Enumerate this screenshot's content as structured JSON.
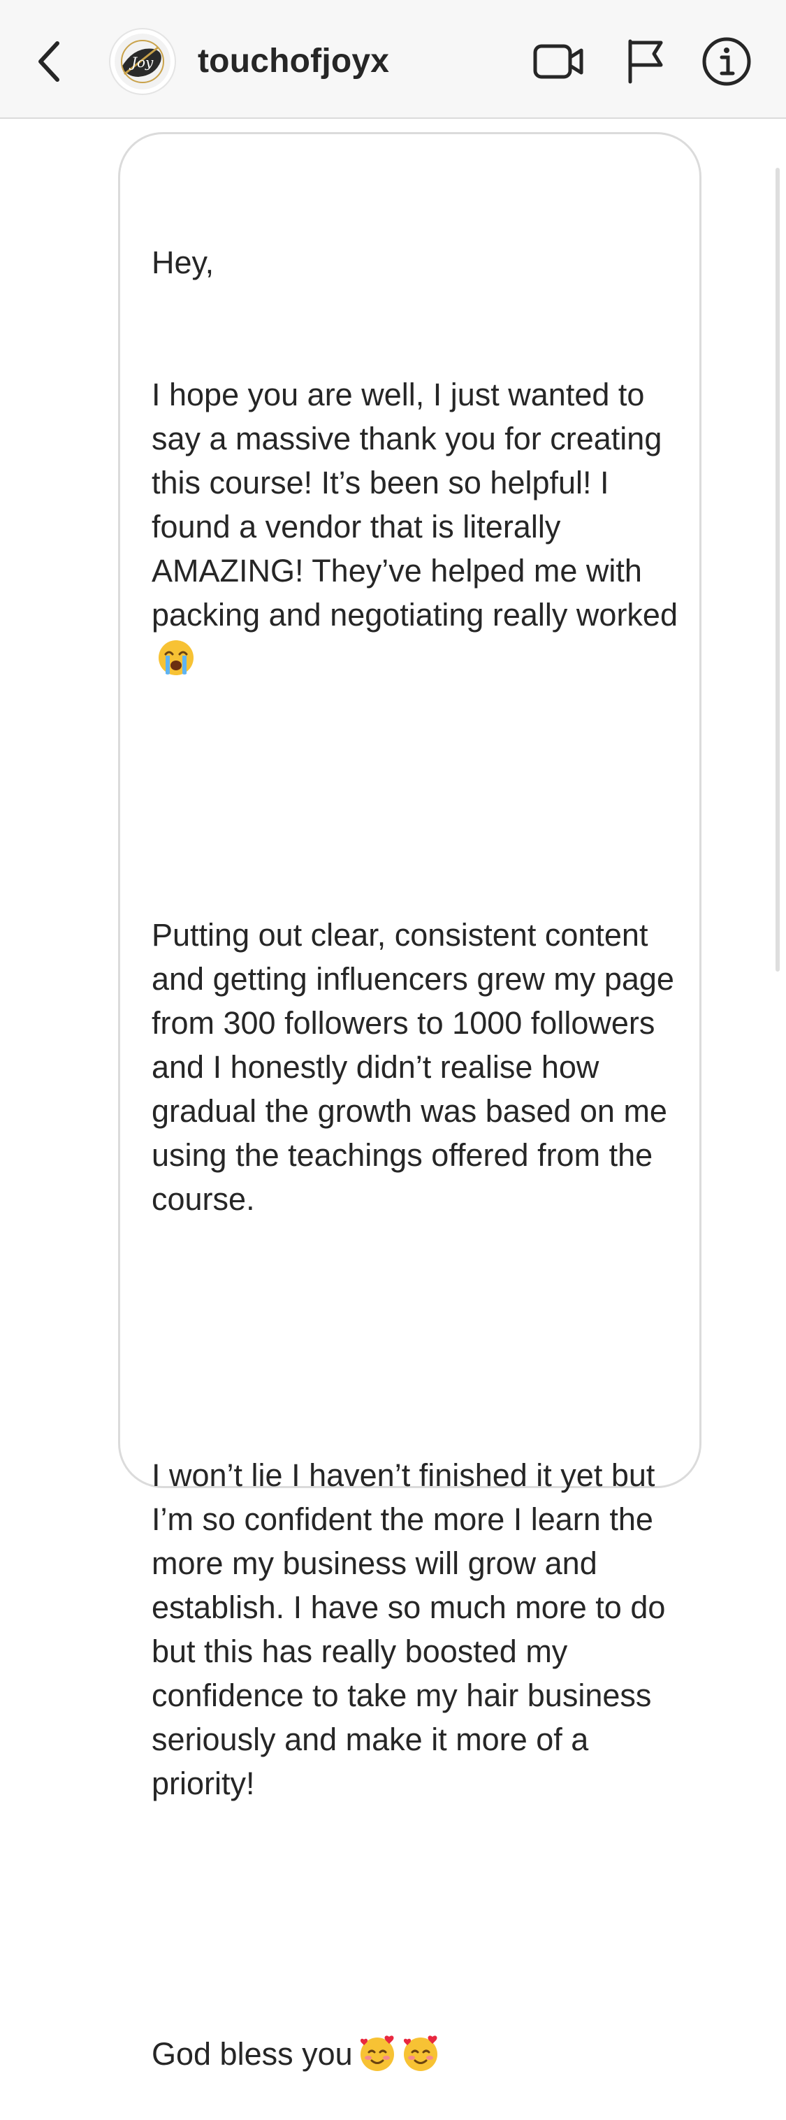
{
  "header": {
    "username": "touchofjoyx",
    "avatar_text": "Joy",
    "icons": [
      "back-chevron-icon",
      "video-camera-icon",
      "flag-icon",
      "info-icon"
    ]
  },
  "message": {
    "line_1": "Hey,",
    "para_1": "I hope you are well, I just wanted to say a massive thank you for creating this course! It’s been so helpful! I found a vendor that is literally AMAZING! They’ve helped me with packing and negotiating really worked",
    "para_2": "Putting out clear, consistent content and getting influencers grew my page from 300 followers to 1000 followers and I honestly didn’t realise how gradual the growth was based on me using the teachings offered from the course.",
    "para_3": "I won’t lie I haven’t finished it yet but I’m so confident the more I learn the more my business will grow and establish. I have so much more to do but this has really boosted my confidence to take my hair business seriously and make it more of a priority!",
    "closing": "God bless you",
    "emojis": [
      "loudly-crying-face",
      "smiling-face-with-hearts",
      "smiling-face-with-hearts"
    ]
  },
  "colors": {
    "header_bg": "#f7f7f7",
    "text": "#262626",
    "bubble_border": "#dbdbdb"
  }
}
